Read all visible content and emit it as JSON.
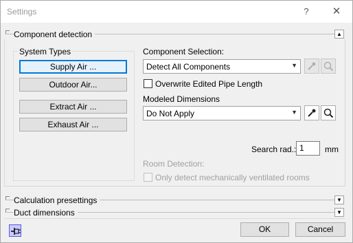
{
  "window": {
    "title": "Settings",
    "help_glyph": "?",
    "close_glyph": "✕"
  },
  "sections": {
    "component_detection": "Component detection",
    "calculation_presettings": "Calculation presettings",
    "duct_dimensions": "Duct dimensions"
  },
  "system_types": {
    "label": "System Types",
    "buttons": [
      "Supply Air ...",
      "Outdoor Air...",
      "Extract Air ...",
      "Exhaust Air ..."
    ]
  },
  "component_selection": {
    "label": "Component Selection:",
    "value": "Detect All Components"
  },
  "overwrite_pipe_length": {
    "label": "Overwrite Edited Pipe Length",
    "checked": false
  },
  "modeled_dimensions": {
    "label": "Modeled Dimensions",
    "value": "Do Not Apply"
  },
  "search_radius": {
    "label": "Search rad.:",
    "value": "1",
    "unit": "mm"
  },
  "room_detection": {
    "label": "Room Detection:",
    "checkbox_label": "Only detect mechanically ventilated rooms",
    "checked": false
  },
  "footer": {
    "ok": "OK",
    "cancel": "Cancel"
  },
  "icons": [
    "help-icon",
    "close-icon",
    "pipette-icon",
    "magnifier-icon",
    "pin-icon"
  ],
  "colors": {
    "focus_border": "#0078d7",
    "pin_fill": "#c9c9ff"
  }
}
